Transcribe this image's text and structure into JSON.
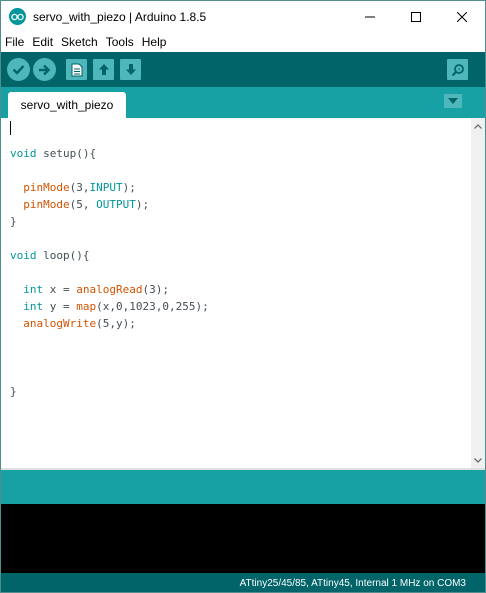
{
  "window": {
    "title": "servo_with_piezo | Arduino 1.8.5",
    "controls": [
      "minimize",
      "maximize",
      "close"
    ]
  },
  "menu": {
    "items": [
      "File",
      "Edit",
      "Sketch",
      "Tools",
      "Help"
    ]
  },
  "toolbar": {
    "buttons": [
      {
        "name": "verify",
        "icon": "check-icon"
      },
      {
        "name": "upload",
        "icon": "arrow-right-icon"
      },
      {
        "name": "new",
        "icon": "file-icon"
      },
      {
        "name": "open",
        "icon": "arrow-up-icon"
      },
      {
        "name": "save",
        "icon": "arrow-down-icon"
      }
    ],
    "right_button": {
      "name": "serial-monitor",
      "icon": "magnifier-icon"
    }
  },
  "tabs": {
    "active": "servo_with_piezo"
  },
  "colors": {
    "toolbar": "#006468",
    "tabbar": "#17a1a5",
    "button": "#4db7bb",
    "keyword": "#00979c",
    "function": "#d35400",
    "console": "#000000"
  },
  "code": {
    "lines": [
      "",
      "void setup(){",
      "",
      "  pinMode(3,INPUT);",
      "  pinMode(5, OUTPUT);",
      "}",
      "",
      "void loop(){",
      "",
      "  int x = analogRead(3);",
      "  int y = map(x,0,1023,0,255);",
      "  analogWrite(5,y);",
      "",
      "",
      "",
      "}"
    ]
  },
  "status": {
    "board": "ATtiny25/45/85, ATtiny45, Internal 1 MHz on COM3"
  }
}
